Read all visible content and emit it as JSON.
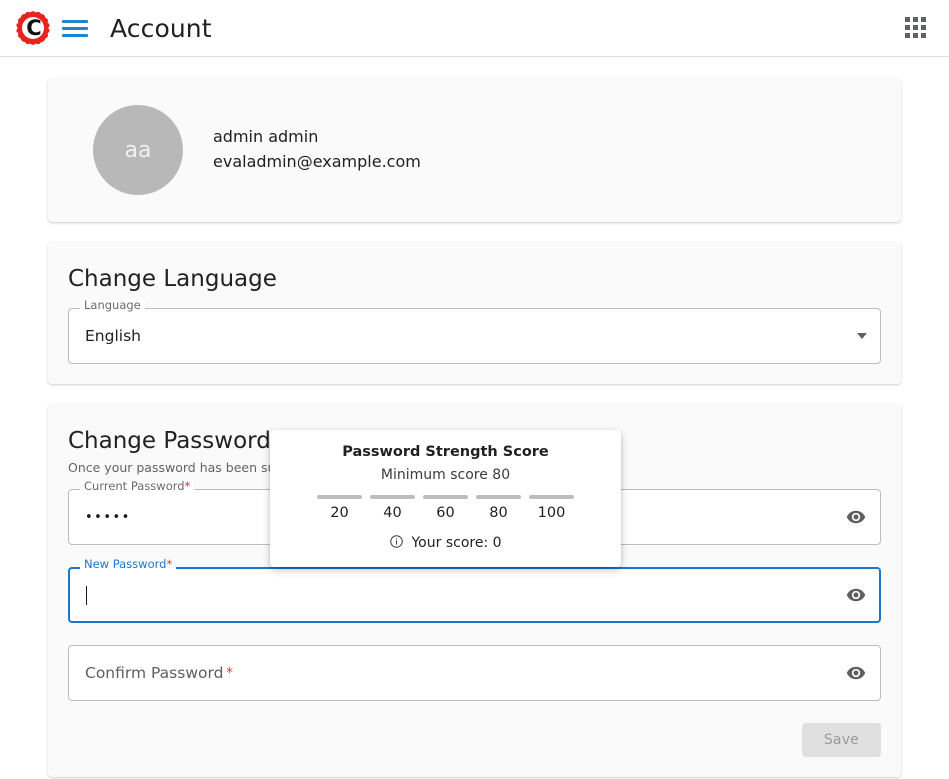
{
  "appbar": {
    "title": "Account",
    "logo_icon": "gear-logo-icon",
    "logo_letter": "C",
    "menu_icon": "hamburger-menu-icon",
    "apps_icon": "apps-grid-icon"
  },
  "profile": {
    "avatar_initials": "aa",
    "name": "admin admin",
    "email": "evaladmin@example.com"
  },
  "language_section": {
    "title": "Change Language",
    "field_label": "Language",
    "selected_value": "English",
    "options": [
      "English"
    ],
    "arrow_icon": "chevron-down-icon"
  },
  "password_section": {
    "title": "Change Password",
    "description": "Once your password has been successful",
    "current": {
      "label": "Current Password",
      "required_mark": "*",
      "value": "•••••",
      "toggle_icon": "eye-visibility-icon"
    },
    "new": {
      "label": "New Password",
      "required_mark": "*",
      "value": "",
      "toggle_icon": "eye-visibility-icon"
    },
    "confirm": {
      "label": "Confirm Password",
      "required_mark": "*",
      "value": "",
      "toggle_icon": "eye-visibility-icon"
    },
    "save_label": "Save"
  },
  "strength_popover": {
    "title": "Password Strength Score",
    "subtitle": "Minimum score 80",
    "scale": [
      "20",
      "40",
      "60",
      "80",
      "100"
    ],
    "info_icon": "info-circle-icon",
    "score_text": "Your score: 0"
  },
  "colors": {
    "accent_blue": "#1976d2",
    "logo_red": "#e8221c",
    "required_red": "#d93025",
    "card_bg": "#fafafa",
    "meter_gray": "#bdbdbd"
  }
}
